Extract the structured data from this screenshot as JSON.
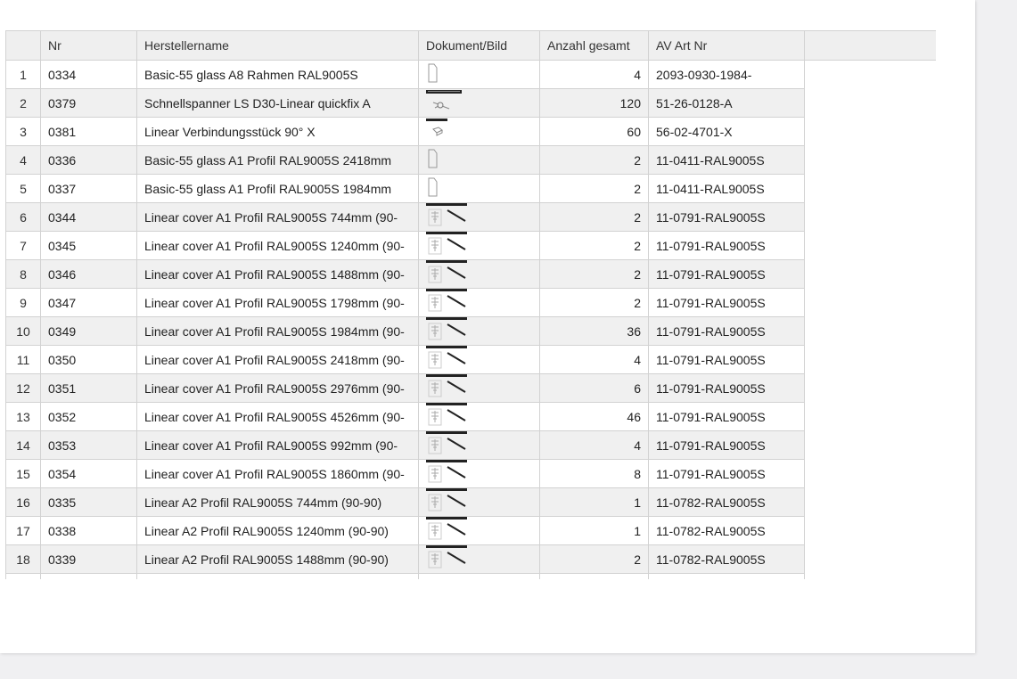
{
  "table": {
    "columns": {
      "index": "",
      "nr": "Nr",
      "hersteller": "Herstellername",
      "dokument": "Dokument/Bild",
      "anzahl": "Anzahl gesamt",
      "avartnr": "AV Art Nr",
      "extra": ""
    },
    "rows": [
      {
        "idx": "1",
        "nr": "0334",
        "name": "Basic-55 glass A8 Rahmen RAL9005S",
        "qty": "4",
        "av": "2093-0930-1984-",
        "icon": "profile-outline-icon"
      },
      {
        "idx": "2",
        "nr": "0379",
        "name": "Schnellspanner LS D30-Linear quickfix A",
        "qty": "120",
        "av": "51-26-0128-A",
        "icon": "quickfix-drawing-icon"
      },
      {
        "idx": "3",
        "nr": "0381",
        "name": "Linear Verbindungsstück 90° X",
        "qty": "60",
        "av": "56-02-4701-X",
        "icon": "connector-drawing-icon"
      },
      {
        "idx": "4",
        "nr": "0336",
        "name": "Basic-55 glass A1 Profil RAL9005S 2418mm",
        "qty": "2",
        "av": "11-0411-RAL9005S",
        "icon": "profile-outline-icon"
      },
      {
        "idx": "5",
        "nr": "0337",
        "name": "Basic-55 glass A1 Profil RAL9005S 1984mm",
        "qty": "2",
        "av": "11-0411-RAL9005S",
        "icon": "profile-outline-icon"
      },
      {
        "idx": "6",
        "nr": "0344",
        "name": "Linear cover A1 Profil RAL9005S 744mm (90-",
        "qty": "2",
        "av": "11-0791-RAL9005S",
        "icon": "profile-drawing-icon"
      },
      {
        "idx": "7",
        "nr": "0345",
        "name": "Linear cover A1 Profil RAL9005S 1240mm (90-",
        "qty": "2",
        "av": "11-0791-RAL9005S",
        "icon": "profile-drawing-icon"
      },
      {
        "idx": "8",
        "nr": "0346",
        "name": "Linear cover A1 Profil RAL9005S 1488mm (90-",
        "qty": "2",
        "av": "11-0791-RAL9005S",
        "icon": "profile-drawing-icon"
      },
      {
        "idx": "9",
        "nr": "0347",
        "name": "Linear cover A1 Profil RAL9005S 1798mm (90-",
        "qty": "2",
        "av": "11-0791-RAL9005S",
        "icon": "profile-drawing-icon"
      },
      {
        "idx": "10",
        "nr": "0349",
        "name": "Linear cover A1 Profil RAL9005S 1984mm (90-",
        "qty": "36",
        "av": "11-0791-RAL9005S",
        "icon": "profile-drawing-icon"
      },
      {
        "idx": "11",
        "nr": "0350",
        "name": "Linear cover A1 Profil  RAL9005S 2418mm (90-",
        "qty": "4",
        "av": "11-0791-RAL9005S",
        "icon": "profile-drawing-icon"
      },
      {
        "idx": "12",
        "nr": "0351",
        "name": "Linear cover A1 Profil RAL9005S 2976mm (90-",
        "qty": "6",
        "av": "11-0791-RAL9005S",
        "icon": "profile-drawing-icon"
      },
      {
        "idx": "13",
        "nr": "0352",
        "name": "Linear cover A1 Profil RAL9005S 4526mm (90-",
        "qty": "46",
        "av": "11-0791-RAL9005S",
        "icon": "profile-drawing-icon"
      },
      {
        "idx": "14",
        "nr": "0353",
        "name": "Linear cover A1 Profil RAL9005S 992mm (90-",
        "qty": "4",
        "av": "11-0791-RAL9005S",
        "icon": "profile-drawing-icon"
      },
      {
        "idx": "15",
        "nr": "0354",
        "name": "Linear cover A1 Profil RAL9005S 1860mm (90-",
        "qty": "8",
        "av": "11-0791-RAL9005S",
        "icon": "profile-drawing-icon"
      },
      {
        "idx": "16",
        "nr": "0335",
        "name": "Linear A2 Profil RAL9005S 744mm (90-90)",
        "qty": "1",
        "av": "11-0782-RAL9005S",
        "icon": "profile-drawing-icon"
      },
      {
        "idx": "17",
        "nr": "0338",
        "name": "Linear A2 Profil RAL9005S 1240mm (90-90)",
        "qty": "1",
        "av": "11-0782-RAL9005S",
        "icon": "profile-drawing-icon"
      },
      {
        "idx": "18",
        "nr": "0339",
        "name": "Linear A2 Profil RAL9005S 1488mm (90-90)",
        "qty": "2",
        "av": "11-0782-RAL9005S",
        "icon": "profile-drawing-icon"
      }
    ]
  },
  "colors": {
    "header_bg": "#efefef",
    "stripe_bg": "#f0f0f0",
    "border": "#d2d2d2",
    "page_bg": "#f0f0f2"
  }
}
